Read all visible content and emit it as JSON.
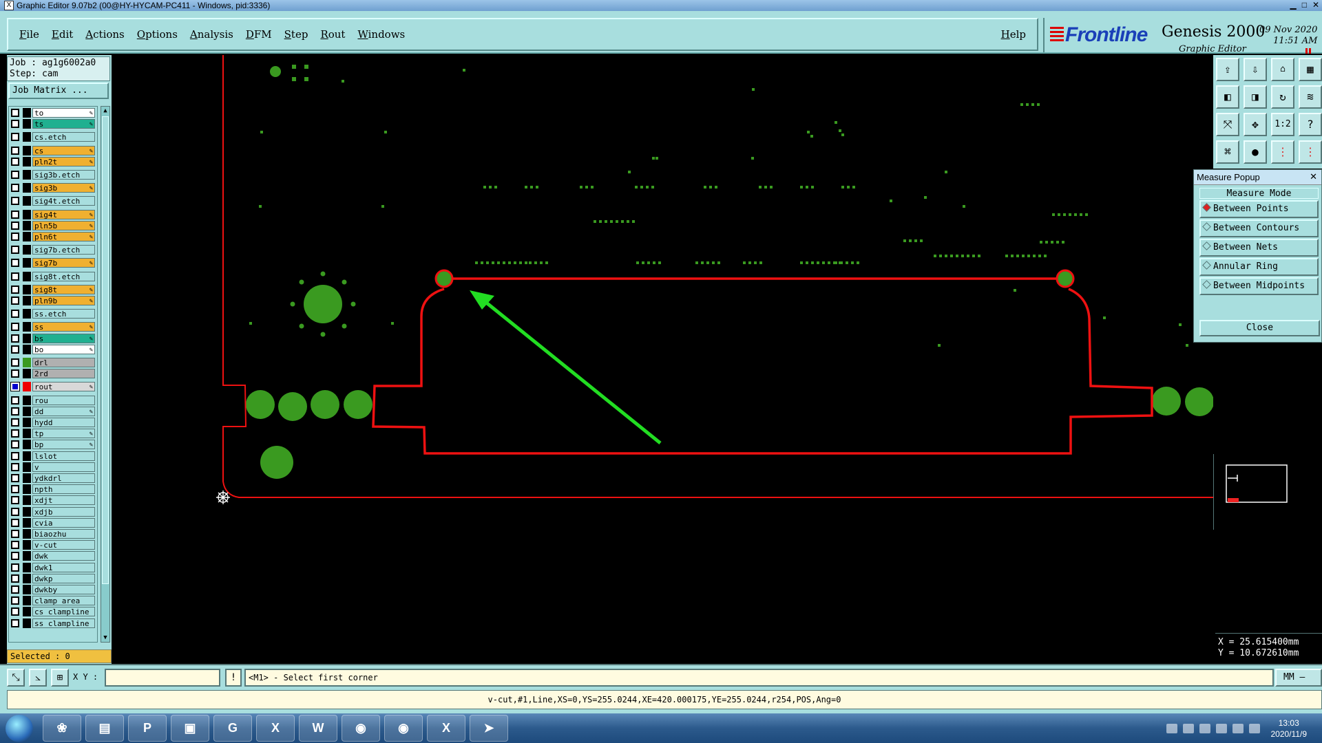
{
  "window": {
    "title": "Graphic Editor 9.07b2 (00@HY-HYCAM-PC411 - Windows, pid:3336)",
    "app_icon": "X"
  },
  "menu": [
    "File",
    "Edit",
    "Actions",
    "Options",
    "Analysis",
    "DFM",
    "Step",
    "Rout",
    "Windows"
  ],
  "help": "Help",
  "brand": {
    "logo": "Frontline",
    "product": "Genesis 2000",
    "subtitle": "Graphic Editor",
    "date": "09 Nov 2020",
    "time": "11:51 AM"
  },
  "job": {
    "job": "Job : ag1g6002a0",
    "step": "Step: cam",
    "matrix": "Job Matrix ..."
  },
  "layers": [
    {
      "name": "to",
      "color": "#ffffff",
      "lock": true
    },
    {
      "name": "ts",
      "color": "#20b090",
      "lock": true
    },
    {
      "name": "cs.etch",
      "color": "#a8dede",
      "lock": false
    },
    {
      "name": "cs",
      "color": "#f0b030",
      "lock": true
    },
    {
      "name": "pln2t",
      "color": "#f0b030",
      "lock": true
    },
    {
      "name": "sig3b.etch",
      "color": "#a8dede",
      "lock": false
    },
    {
      "name": "sig3b",
      "color": "#f0b030",
      "lock": true
    },
    {
      "name": "sig4t.etch",
      "color": "#a8dede",
      "lock": false
    },
    {
      "name": "sig4t",
      "color": "#f0b030",
      "lock": true
    },
    {
      "name": "pln5b",
      "color": "#f0b030",
      "lock": true
    },
    {
      "name": "pln6t",
      "color": "#f0b030",
      "lock": true
    },
    {
      "name": "sig7b.etch",
      "color": "#a8dede",
      "lock": false
    },
    {
      "name": "sig7b",
      "color": "#f0b030",
      "lock": true
    },
    {
      "name": "sig8t.etch",
      "color": "#a8dede",
      "lock": false
    },
    {
      "name": "sig8t",
      "color": "#f0b030",
      "lock": true
    },
    {
      "name": "pln9b",
      "color": "#f0b030",
      "lock": true
    },
    {
      "name": "ss.etch",
      "color": "#a8dede",
      "lock": false
    },
    {
      "name": "ss",
      "color": "#f0b030",
      "lock": true
    },
    {
      "name": "bs",
      "color": "#20b090",
      "lock": true
    },
    {
      "name": "bo",
      "color": "#ffffff",
      "lock": true
    },
    {
      "name": "drl",
      "color": "#b0b0b0",
      "lock": false,
      "swatch": "#3a9a20"
    },
    {
      "name": "2rd",
      "color": "#b0b0b0",
      "lock": false
    },
    {
      "name": "rout",
      "color": "#d8d8d8",
      "lock": true,
      "swatch": "#ee0000",
      "checked": true
    },
    {
      "name": "rou",
      "color": "#a8dede",
      "lock": false
    },
    {
      "name": "dd",
      "color": "#a8dede",
      "lock": true
    },
    {
      "name": "hydd",
      "color": "#a8dede",
      "lock": false
    },
    {
      "name": "tp",
      "color": "#a8dede",
      "lock": true
    },
    {
      "name": "bp",
      "color": "#a8dede",
      "lock": true
    },
    {
      "name": "lslot",
      "color": "#a8dede",
      "lock": false
    },
    {
      "name": "v",
      "color": "#a8dede",
      "lock": false
    },
    {
      "name": "ydkdrl",
      "color": "#a8dede",
      "lock": false
    },
    {
      "name": "npth",
      "color": "#a8dede",
      "lock": false
    },
    {
      "name": "xdjt",
      "color": "#a8dede",
      "lock": false
    },
    {
      "name": "xdjb",
      "color": "#a8dede",
      "lock": false
    },
    {
      "name": "cvia",
      "color": "#a8dede",
      "lock": false
    },
    {
      "name": "biaozhu",
      "color": "#a8dede",
      "lock": false
    },
    {
      "name": "v-cut",
      "color": "#a8dede",
      "lock": false
    },
    {
      "name": "dwk",
      "color": "#a8dede",
      "lock": false
    },
    {
      "name": "dwk1",
      "color": "#a8dede",
      "lock": false
    },
    {
      "name": "dwkp",
      "color": "#a8dede",
      "lock": false
    },
    {
      "name": "dwkby",
      "color": "#a8dede",
      "lock": false
    },
    {
      "name": "clamp_area",
      "color": "#a8dede",
      "lock": false
    },
    {
      "name": "cs_clampline",
      "color": "#a8dede",
      "lock": false
    },
    {
      "name": "ss_clampline",
      "color": "#a8dede",
      "lock": false
    }
  ],
  "selected": "Selected : 0",
  "toolbar_icons": [
    "import-icon",
    "export-icon",
    "home-icon",
    "window-icon",
    "pan-left-icon",
    "pan-right-icon",
    "zoom-fit-icon",
    "script-icon",
    "zoom-extents-icon",
    "zoom-center-icon",
    "scale-1-2-icon",
    "query-icon",
    "measure-icon",
    "snap-icon",
    "net-left-icon",
    "net-right-icon"
  ],
  "measure_popup": {
    "title": "Measure Popup",
    "mode_label": "Measure Mode",
    "options": [
      "Between Points",
      "Between Contours",
      "Between Nets",
      "Annular Ring",
      "Between Midpoints"
    ],
    "selected": 0,
    "close": "Close"
  },
  "coords": {
    "x": "X = 25.615400mm",
    "y": "Y = 10.672610mm"
  },
  "command": {
    "xy_label": "X Y :",
    "xy_value": "",
    "excl": "!",
    "prompt": "<M1> - Select first corner",
    "units": "MM"
  },
  "status": "v-cut,#1,Line,XS=0,YS=255.0244,XE=420.000175,YE=255.0244,r254,POS,Ang=0",
  "taskbar": {
    "apps": [
      "folder",
      "notepad",
      "P",
      "save",
      "G",
      "X",
      "W",
      "eye",
      "eye2",
      "X",
      "msg"
    ],
    "clock_time": "13:03",
    "clock_date": "2020/11/9"
  },
  "colors": {
    "panel": "#a8dede",
    "rout": "#ee1111",
    "pad": "#3a9a20",
    "arrow": "#22dd22"
  }
}
